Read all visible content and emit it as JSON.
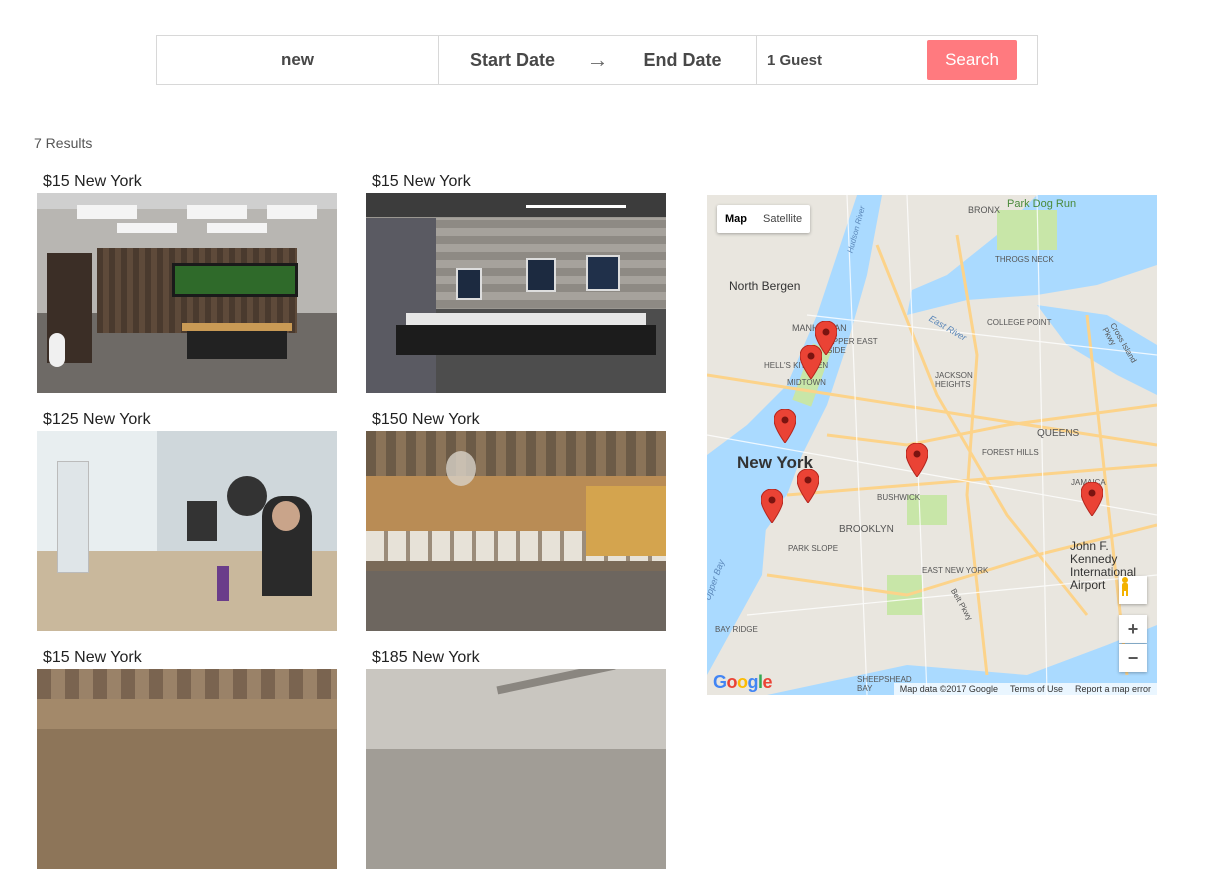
{
  "search": {
    "location_value": "new",
    "start_date": "Start Date",
    "arrow": "→",
    "end_date": "End Date",
    "guests": "1 Guest",
    "button": "Search"
  },
  "results": {
    "count_label": "7 Results"
  },
  "listings": [
    {
      "title": "$15 New York"
    },
    {
      "title": "$15 New York"
    },
    {
      "title": "$125 New York"
    },
    {
      "title": "$150 New York"
    },
    {
      "title": "$15 New York"
    },
    {
      "title": "$185 New York"
    }
  ],
  "map": {
    "toggle_map": "Map",
    "toggle_satellite": "Satellite",
    "zoom_in": "+",
    "zoom_out": "−",
    "attribution": "Map data ©2017 Google",
    "terms": "Terms of Use",
    "report": "Report a map error",
    "logo": "Google",
    "labels": {
      "north_bergen": "North Bergen",
      "new_york": "New York",
      "manhattan": "MANHATTAN",
      "upper_east": "UPPER EAST SIDE",
      "hells_kitchen": "HELL'S KITCHEN",
      "midtown": "MIDTOWN",
      "bronx": "BRONX",
      "throgs_neck": "THROGS NECK",
      "college_point": "COLLEGE POINT",
      "jackson_heights": "JACKSON HEIGHTS",
      "queens": "QUEENS",
      "forest_hills": "FOREST HILLS",
      "jamaica": "JAMAICA",
      "bushwick": "BUSHWICK",
      "brooklyn": "BROOKLYN",
      "park_slope": "PARK SLOPE",
      "east_new_york": "EAST NEW YORK",
      "bay_ridge": "BAY RIDGE",
      "sheepshead_bay": "SHEEPSHEAD BAY",
      "jfk": "John F. Kennedy International Airport",
      "park_dog_run": "Park Dog Run",
      "east_river": "East River",
      "upper_bay": "Upper Bay",
      "belt_pkwy": "Belt Pkwy",
      "cross_island": "Cross Island Pkwy",
      "hudson": "Hudson River"
    }
  }
}
